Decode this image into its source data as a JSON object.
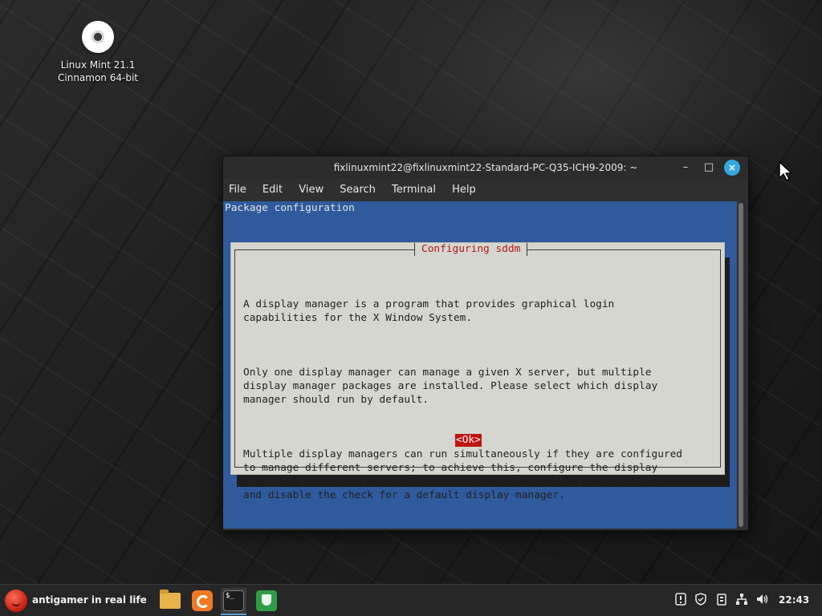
{
  "desktop": {
    "icon_label_line1": "Linux Mint 21.1",
    "icon_label_line2": "Cinnamon 64-bit"
  },
  "window": {
    "title": "fixlinuxmint22@fixlinuxmint22-Standard-PC-Q35-ICH9-2009: ~",
    "minimize_symbol": "–",
    "maximize_symbol": "□",
    "close_symbol": "×",
    "menu": [
      "File",
      "Edit",
      "View",
      "Search",
      "Terminal",
      "Help"
    ]
  },
  "terminal": {
    "header": "Package configuration",
    "dialog": {
      "title": "Configuring sddm",
      "paragraphs": [
        "A display manager is a program that provides graphical login\ncapabilities for the X Window System.",
        "Only one display manager can manage a given X server, but multiple\ndisplay manager packages are installed. Please select which display\nmanager should run by default.",
        "Multiple display managers can run simultaneously if they are configured\nto manage different servers; to achieve this, configure the display\nmanagers accordingly, edit each of their init scripts in /etc/init.d,\nand disable the check for a default display manager."
      ],
      "ok_label": "<Ok>",
      "ok_color": "#c0140f"
    },
    "background_color": "#2f5a9c"
  },
  "taskbar": {
    "menu_label": "antigamer in real life",
    "apps": [
      {
        "name": "folder-icon"
      },
      {
        "name": "firefox-icon"
      },
      {
        "name": "terminal-icon",
        "glyph": "$_"
      },
      {
        "name": "shield-icon"
      }
    ],
    "tray_icons": [
      "notification-icon",
      "security-icon",
      "clipboard-icon",
      "network-icon",
      "volume-icon"
    ],
    "clock": "22:43"
  }
}
